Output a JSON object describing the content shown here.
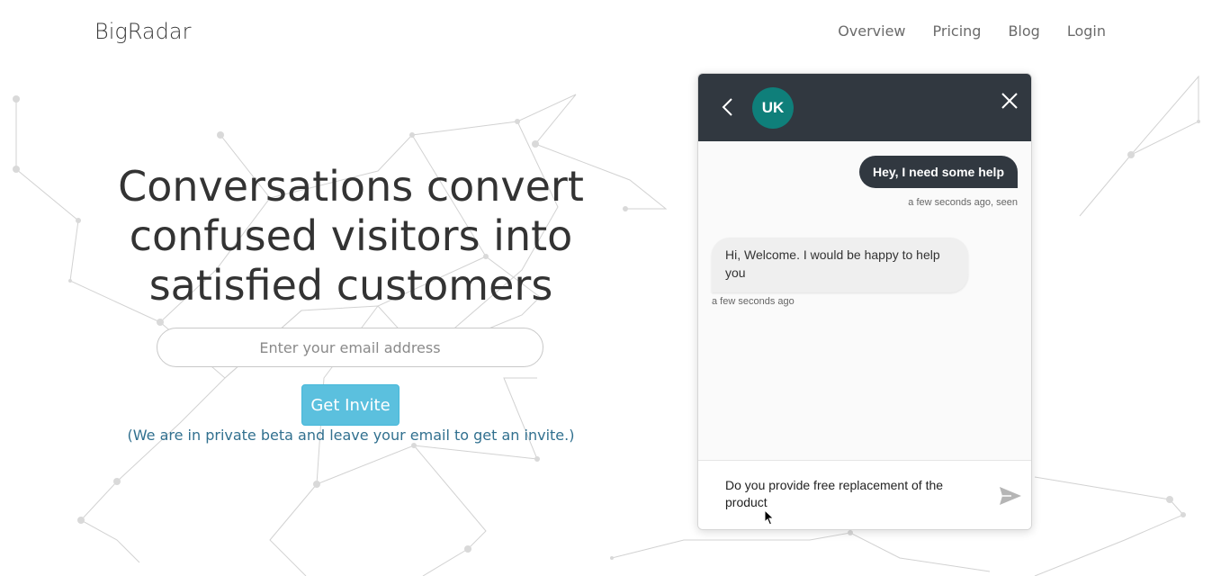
{
  "nav": {
    "brand": "BigRadar",
    "links": [
      "Overview",
      "Pricing",
      "Blog",
      "Login"
    ]
  },
  "hero": {
    "title_lines": [
      "Conversations convert",
      "confused visitors into",
      "satisfied customers"
    ],
    "email_placeholder": "Enter your email address",
    "invite_button": "Get Invite",
    "beta_note": "(We are in private beta and leave your email to get an invite.)"
  },
  "chat": {
    "avatar_initials": "UK",
    "messages": [
      {
        "direction": "out",
        "text": "Hey, I need some help",
        "meta": "a few seconds ago, seen"
      },
      {
        "direction": "in",
        "text": "Hi, Welcome. I would be happy to help you",
        "meta": "a few seconds ago"
      }
    ],
    "input_value": "Do you provide free replacement of the product"
  },
  "colors": {
    "chat_header": "#313840",
    "avatar": "#0f7f7a",
    "invite_button": "#5bc0de",
    "beta_note": "#31708f"
  },
  "icons": [
    "back-arrow-icon",
    "close-icon",
    "send-icon",
    "mouse-cursor-icon"
  ]
}
